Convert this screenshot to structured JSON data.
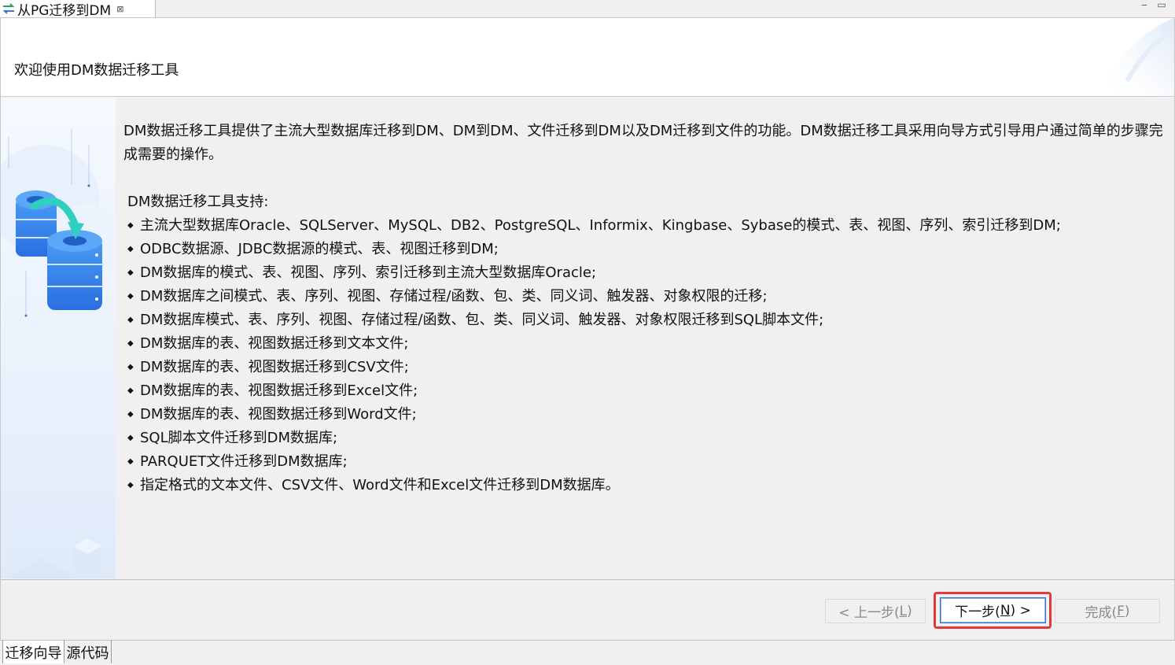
{
  "tab": {
    "title": "从PG迁移到DM",
    "close_glyph": "⊠"
  },
  "window_controls": {
    "minimize": "‒",
    "maximize": "▭"
  },
  "header": {
    "title": "欢迎使用DM数据迁移工具"
  },
  "content": {
    "intro": "DM数据迁移工具提供了主流大型数据库迁移到DM、DM到DM、文件迁移到DM以及DM迁移到文件的功能。DM数据迁移工具采用向导方式引导用户通过简单的步骤完成需要的操作。",
    "support_heading": "DM数据迁移工具支持:",
    "bullet": "◆",
    "features": [
      "主流大型数据库Oracle、SQLServer、MySQL、DB2、PostgreSQL、Informix、Kingbase、Sybase的模式、表、视图、序列、索引迁移到DM;",
      "ODBC数据源、JDBC数据源的模式、表、视图迁移到DM;",
      "DM数据库的模式、表、视图、序列、索引迁移到主流大型数据库Oracle;",
      "DM数据库之间模式、表、序列、视图、存储过程/函数、包、类、同义词、触发器、对象权限的迁移;",
      "DM数据库模式、表、序列、视图、存储过程/函数、包、类、同义词、触发器、对象权限迁移到SQL脚本文件;",
      "DM数据库的表、视图数据迁移到文本文件;",
      "DM数据库的表、视图数据迁移到CSV文件;",
      "DM数据库的表、视图数据迁移到Excel文件;",
      "DM数据库的表、视图数据迁移到Word文件;",
      "SQL脚本文件迁移到DM数据库;",
      "PARQUET文件迁移到DM数据库;",
      "指定格式的文本文件、CSV文件、Word文件和Excel文件迁移到DM数据库。"
    ]
  },
  "buttons": {
    "back": {
      "prefix": "< 上一步(",
      "mnemonic": "L",
      "suffix": ")",
      "enabled": false
    },
    "next": {
      "prefix": "下一步(",
      "mnemonic": "N",
      "suffix": ") >",
      "enabled": true,
      "highlighted": true
    },
    "finish": {
      "prefix": "完成(",
      "mnemonic": "F",
      "suffix": ")",
      "enabled": false
    }
  },
  "bottom_tabs": [
    {
      "label": "迁移向导",
      "active": true
    },
    {
      "label": "源代码",
      "active": false
    }
  ],
  "colors": {
    "highlight": "#e03b3b",
    "accent": "#2b6fcf"
  }
}
